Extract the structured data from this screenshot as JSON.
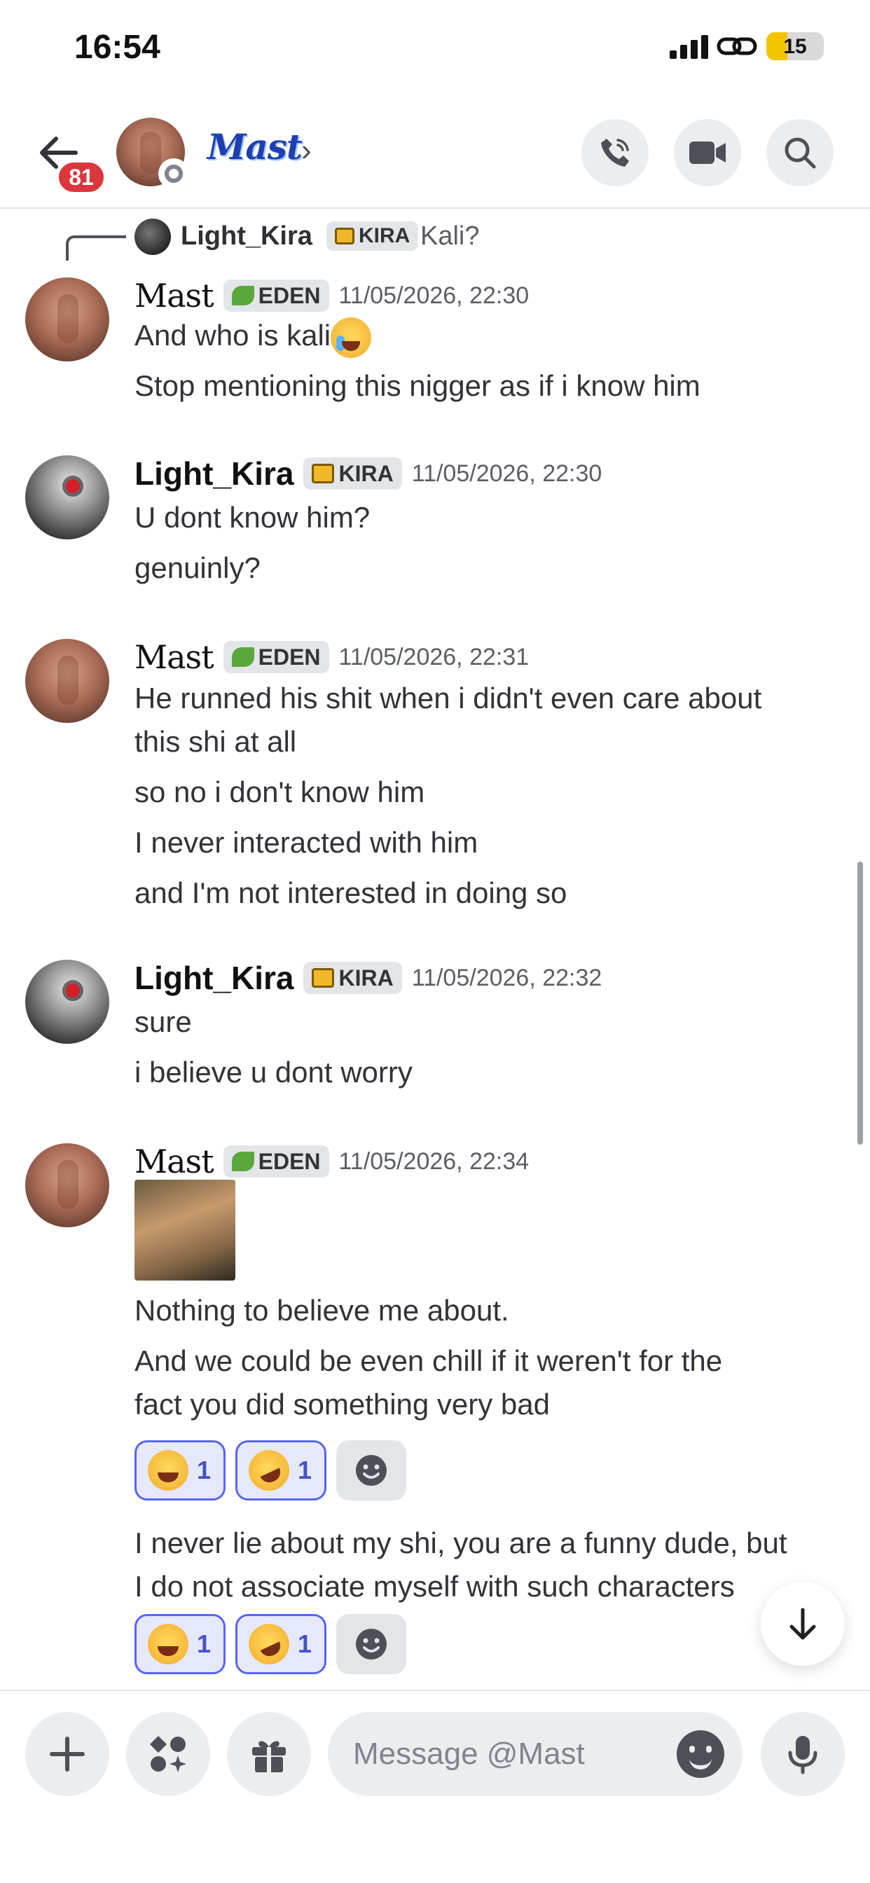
{
  "status_bar": {
    "time": "16:54",
    "battery": "15"
  },
  "header": {
    "unread_count": "81",
    "contact_name": "Mast",
    "chevron": "›",
    "icons": [
      "back-arrow-icon",
      "phone-icon",
      "video-camera-icon",
      "search-icon"
    ]
  },
  "reply_preview": {
    "author": "Light_Kira",
    "tag": "KIRA",
    "text": "Kali?"
  },
  "messages": [
    {
      "author": "Mast",
      "tag": "EDEN",
      "timestamp": "11/05/2026, 22:30",
      "lines": [
        "And who is kali",
        "Stop mentioning this nigger as if i know him"
      ]
    },
    {
      "author": "Light_Kira",
      "tag": "KIRA",
      "timestamp": "11/05/2026, 22:30",
      "lines": [
        "U dont know him?",
        "genuinly?"
      ]
    },
    {
      "author": "Mast",
      "tag": "EDEN",
      "timestamp": "11/05/2026, 22:31",
      "lines": [
        "He runned his shit when i didn't even care about",
        "this shi at all",
        "so no i don't know him",
        "I never interacted with him",
        "and I'm not interested in doing so"
      ]
    },
    {
      "author": "Light_Kira",
      "tag": "KIRA",
      "timestamp": "11/05/2026, 22:32",
      "lines": [
        "sure",
        "i believe u dont worry"
      ]
    },
    {
      "author": "Mast",
      "tag": "EDEN",
      "timestamp": "11/05/2026, 22:34",
      "lines": [
        "Nothing to believe me about.",
        "And we could be even chill if it weren't for the",
        "fact you did something very bad",
        "I never lie about my shi, you are a funny dude, but",
        "I do not associate myself with such characters"
      ],
      "reactions_1": [
        {
          "emoji": "joy-emoji",
          "count": "1"
        },
        {
          "emoji": "rofl-emoji",
          "count": "1"
        }
      ],
      "reactions_2": [
        {
          "emoji": "joy-emoji",
          "count": "1"
        },
        {
          "emoji": "rofl-emoji",
          "count": "1"
        }
      ]
    }
  ],
  "composer": {
    "placeholder": "Message @Mast",
    "icons": [
      "plus-icon",
      "apps-icon",
      "gift-icon",
      "emoji-icon",
      "microphone-icon"
    ]
  },
  "colors": {
    "accent": "#5865f2",
    "badge": "#da373c",
    "name_gradient": "#1d3fb0"
  }
}
